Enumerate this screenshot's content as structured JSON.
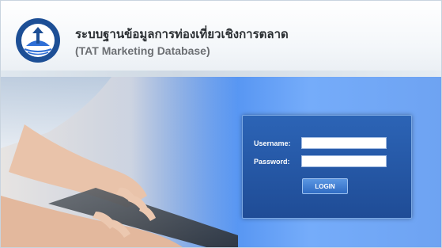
{
  "header": {
    "title_thai": "ระบบฐานข้อมูลการท่องเที่ยวเชิงการตลาด",
    "title_english": "(TAT Marketing Database)",
    "logo_icon": "tat-logo-icon"
  },
  "login_form": {
    "username_label": "Username:",
    "username_value": "",
    "password_label": "Password:",
    "password_value": "",
    "login_button_label": "LOGIN"
  },
  "colors": {
    "panel": "#2457a8",
    "accent": "#2f6fd6",
    "header_background": "#ffffff"
  },
  "hero": {
    "image": "hands-typing-on-laptop"
  }
}
